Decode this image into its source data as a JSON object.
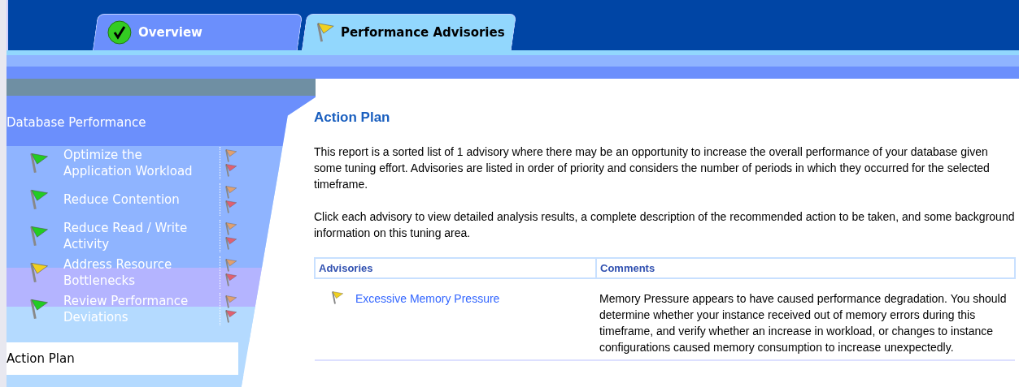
{
  "tabs": [
    {
      "label": "Overview",
      "selected": false
    },
    {
      "label": "Performance Advisories",
      "selected": true
    }
  ],
  "sidebar": {
    "header": "Database Performance",
    "items": [
      {
        "label": "Optimize the Application Workload",
        "color": "#22cc22"
      },
      {
        "label": "Reduce Contention",
        "color": "#22cc22"
      },
      {
        "label": "Reduce Read / Write Activity",
        "color": "#22cc22"
      },
      {
        "label": "Address Resource Bottlenecks",
        "color": "#f0d020"
      },
      {
        "label": "Review Performance Deviations",
        "color": "#22cc22"
      }
    ],
    "action_plan": {
      "label": "Action Plan",
      "selected": true
    }
  },
  "content": {
    "title": "Action Plan",
    "paragraphs": [
      "This report is a sorted list of 1 advisory where there may be an opportunity to increase the overall performance of your database given some tuning effort.  Advisories are listed in order of priority and considers the number of periods in which they occurred for the selected timeframe.",
      "Click each advisory to view detailed analysis results, a complete description of the recommended action to be taken, and some background information on this tuning area."
    ],
    "table": {
      "columns": [
        "Advisories",
        "Comments"
      ],
      "rows": [
        {
          "advisory": "Excessive Memory Pressure",
          "color": "#f0d020",
          "comment": "Memory Pressure appears to have caused performance degradation. You should determine whether your instance received out of memory errors during this timeframe, and verify whether an increase in workload, or changes to instance configurations caused memory consumption to increase unexpectedly."
        }
      ]
    }
  }
}
